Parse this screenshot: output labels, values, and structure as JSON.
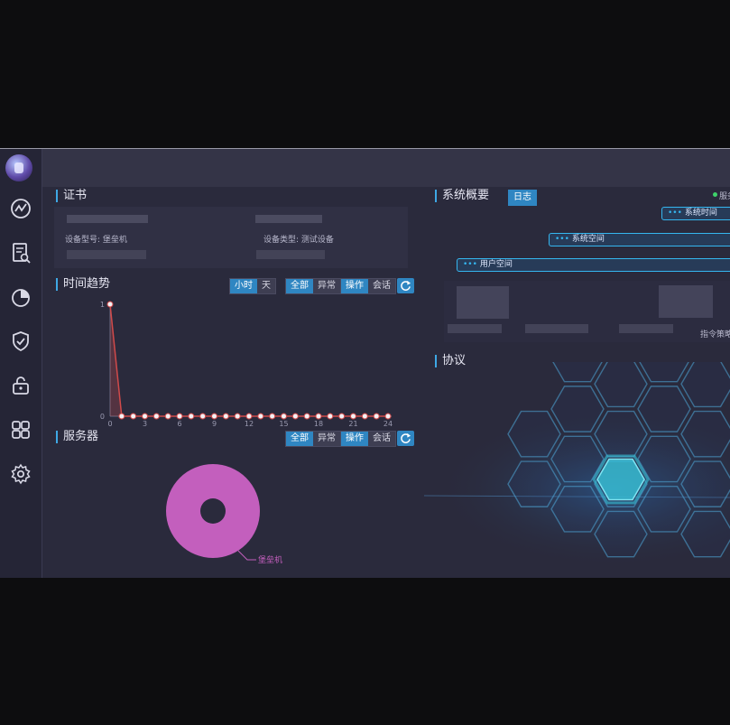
{
  "sidebar": {
    "icons": [
      "trend-icon",
      "report-search-icon",
      "pie-chart-icon",
      "shield-check-icon",
      "unlock-icon",
      "apps-grid-icon",
      "gear-icon"
    ]
  },
  "certificate": {
    "title": "证书",
    "device_model": "设备型号: 堡垒机",
    "device_type": "设备类型: 测试设备"
  },
  "overview": {
    "title": "系统概要",
    "log_button": "日志",
    "status_label": "服务",
    "system_time_label": "系统时间",
    "system_space_label": "系统空间",
    "user_space_label": "用户空间",
    "command_policy_label": "指令策略"
  },
  "trend": {
    "title": "时间趋势",
    "filters": {
      "hour": "小时",
      "day": "天",
      "all": "全部",
      "abnormal": "异常",
      "operation": "操作",
      "session": "会话"
    }
  },
  "protocol": {
    "title": "协议"
  },
  "servers": {
    "title": "服务器",
    "filters": {
      "all": "全部",
      "abnormal": "异常",
      "operation": "操作",
      "session": "会话"
    },
    "legend_label": "堡垒机"
  },
  "colors": {
    "accent": "#2f86c2",
    "line": "#d14a4a",
    "donut": "#c35fbd",
    "hex_glow": "#38c3d8"
  },
  "chart_data": [
    {
      "type": "line",
      "x": [
        0,
        1,
        2,
        3,
        4,
        5,
        6,
        7,
        8,
        9,
        10,
        11,
        12,
        13,
        14,
        15,
        16,
        17,
        18,
        19,
        20,
        21,
        22,
        23,
        24
      ],
      "y": [
        1,
        0,
        0,
        0,
        0,
        0,
        0,
        0,
        0,
        0,
        0,
        0,
        0,
        0,
        0,
        0,
        0,
        0,
        0,
        0,
        0,
        0,
        0,
        0,
        0
      ],
      "xticks": [
        "0",
        "3",
        "6",
        "9",
        "12",
        "15",
        "18",
        "21",
        "24"
      ],
      "yticks": [
        "0",
        "1"
      ],
      "ylim": [
        0,
        1
      ],
      "xlim": [
        0,
        24
      ]
    },
    {
      "type": "pie",
      "labels": [
        "堡垒机"
      ],
      "values": [
        100
      ]
    }
  ]
}
